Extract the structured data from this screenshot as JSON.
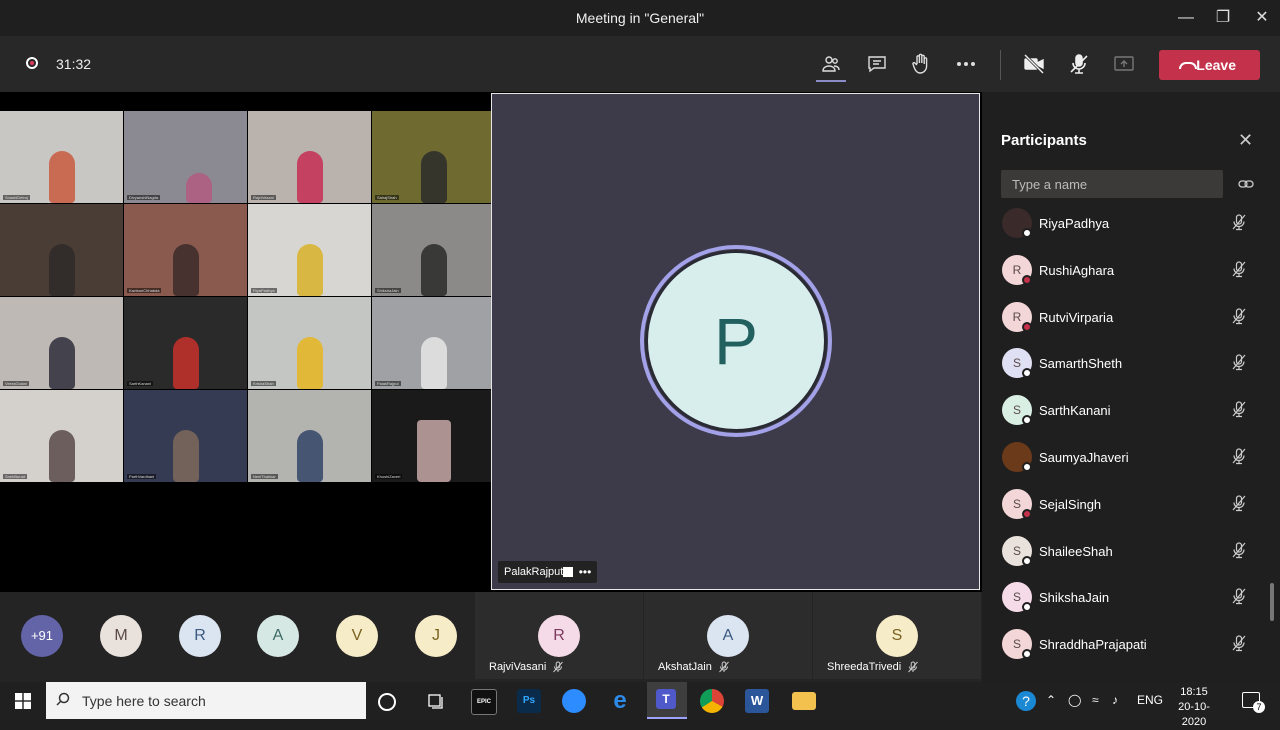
{
  "window": {
    "title": "Meeting in \"General\""
  },
  "toolbar": {
    "timer": "31:32",
    "leave_label": "Leave"
  },
  "main_video": {
    "initial": "P",
    "label": "PalakRajput",
    "more": "•••"
  },
  "grid_names": [
    "SnashiDetroj",
    "DivyanshiNagda",
    "RajviVasani",
    "SahajShah",
    "",
    "KavisonChhabda",
    "RiyaPadhya",
    "ShikshaJain",
    "VeeraGolani",
    "SarthKanani",
    "KrishaShah",
    "PalakRajput",
    "SnehBurad",
    "ParthVardhani",
    "NeelThakkar",
    "KhushiZaveri"
  ],
  "participants": {
    "title": "Participants",
    "search_placeholder": "Type a name",
    "items": [
      {
        "name": "RiyaPadhya",
        "initial": "",
        "bg": "#3a2a2a",
        "status": "#ffffff"
      },
      {
        "name": "RushiAghara",
        "initial": "R",
        "bg": "#f3d6d8",
        "status": "#c4314b"
      },
      {
        "name": "RutviVirparia",
        "initial": "R",
        "bg": "#f3d6d8",
        "status": "#c4314b"
      },
      {
        "name": "SamarthSheth",
        "initial": "S",
        "bg": "#dfe0f3",
        "status": "#ffffff"
      },
      {
        "name": "SarthKanani",
        "initial": "S",
        "bg": "#d9efe3",
        "status": "#ffffff"
      },
      {
        "name": "SaumyaJhaveri",
        "initial": "",
        "bg": "#6b3a1a",
        "status": "#ffffff"
      },
      {
        "name": "SejalSingh",
        "initial": "S",
        "bg": "#f3d6d8",
        "status": "#c4314b"
      },
      {
        "name": "ShaileeShah",
        "initial": "S",
        "bg": "#e9e1dc",
        "status": "#ffffff"
      },
      {
        "name": "ShikshaJain",
        "initial": "S",
        "bg": "#f5dbe8",
        "status": "#ffffff"
      },
      {
        "name": "ShraddhaPrajapati",
        "initial": "S",
        "bg": "#f3d6d8",
        "status": "#ffffff"
      }
    ]
  },
  "bottom_bar": {
    "avatars": [
      {
        "text": "+91",
        "bg": "#6264a7",
        "fg": "#ffffff"
      },
      {
        "text": "M",
        "bg": "#e9e1dc",
        "fg": "#5b4a44"
      },
      {
        "text": "R",
        "bg": "#dbe5f1",
        "fg": "#3c5a80"
      },
      {
        "text": "A",
        "bg": "#d5e8e4",
        "fg": "#3d6b64"
      },
      {
        "text": "V",
        "bg": "#f7ecc8",
        "fg": "#7a6220"
      },
      {
        "text": "J",
        "bg": "#f7ecc8",
        "fg": "#7a6220"
      }
    ],
    "cards": [
      {
        "initial": "R",
        "name": "RajviVasani",
        "bg": "#f5dbe8",
        "fg": "#7d3b60"
      },
      {
        "initial": "A",
        "name": "AkshatJain",
        "bg": "#dbe5f1",
        "fg": "#3c5a80"
      },
      {
        "initial": "S",
        "name": "ShreedaTrivedi",
        "bg": "#f7ecc8",
        "fg": "#7a6220"
      }
    ]
  },
  "taskbar": {
    "search_placeholder": "Type here to search",
    "lang": "ENG",
    "time": "18:15",
    "date": "20-10-2020",
    "notifications": "7"
  }
}
